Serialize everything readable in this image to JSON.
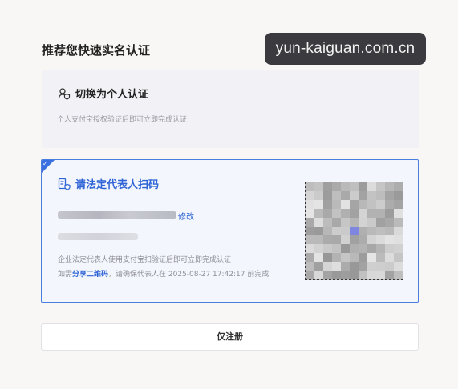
{
  "watermark": {
    "text": "yun-kaiguan.com.cn"
  },
  "page": {
    "title": "推荐您快速实名认证"
  },
  "personal_card": {
    "icon": "person-shield-icon",
    "label": "切换为个人认证",
    "description": "个人支付宝授权验证后即可立即完成认证"
  },
  "enterprise_card": {
    "icon": "document-shield-icon",
    "label": "请法定代表人扫码",
    "edit_label": "修改",
    "description": "企业法定代表人使用支付宝扫验证后即可立即完成认证",
    "share_prefix": "如需",
    "share_link": "分享二维码",
    "share_suffix": "，请确保代表人在  2025-08-27 17:42:17 前完成",
    "selected": true
  },
  "register_button": {
    "label": "仅注册"
  },
  "colors": {
    "accent": "#2f64d6",
    "selected_border": "#4a7de0",
    "watermark_bg": "#3b3b3f"
  }
}
